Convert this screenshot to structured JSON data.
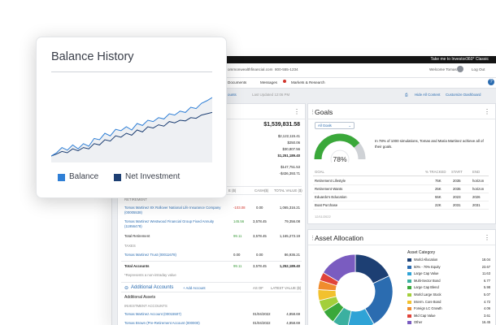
{
  "colors": {
    "accent": "#2b6cb0",
    "balance": "#2f7fd6",
    "net_investment": "#1d3f73",
    "goal_green": "#3aa83a",
    "goal_grey": "#cfd2d6"
  },
  "header": {
    "top_link": "Take me to Investor360° Classic",
    "site_email": "ommonwealthfinancial.com",
    "phone": "800-555-1234",
    "welcome": "Welcome Tomas",
    "logout": "Log Out"
  },
  "nav": {
    "items": [
      "Documents",
      "Messages",
      "Markets & Research"
    ]
  },
  "subbar": {
    "accounts_dropdown": "ounts",
    "last_updated": "Last Updated 12:06 PM",
    "hide_all": "Hide All Content",
    "customize": "Customize Dashboard"
  },
  "balance_card": {
    "title": "Balance History",
    "legend_balance": "Balance",
    "legend_net": "Net Investment",
    "balance_series": [
      0.05,
      0.1,
      0.18,
      0.14,
      0.22,
      0.16,
      0.24,
      0.2,
      0.32,
      0.3,
      0.4,
      0.36,
      0.46,
      0.44,
      0.5,
      0.45,
      0.55,
      0.52,
      0.6,
      0.58,
      0.64,
      0.62,
      0.7,
      0.68,
      0.74,
      0.72,
      0.8,
      0.78,
      0.86,
      0.9,
      0.95
    ],
    "net_series": [
      0.05,
      0.08,
      0.12,
      0.1,
      0.16,
      0.13,
      0.18,
      0.16,
      0.24,
      0.22,
      0.3,
      0.28,
      0.36,
      0.34,
      0.4,
      0.37,
      0.45,
      0.42,
      0.5,
      0.48,
      0.53,
      0.51,
      0.58,
      0.56,
      0.6,
      0.59,
      0.64,
      0.63,
      0.68,
      0.7,
      0.72
    ]
  },
  "left": {
    "total_main": "$1,539,831.58",
    "amounts": [
      "$2,122,115.41",
      "$250.06",
      "$30,807.56",
      "$1,251,189.40"
    ],
    "amounts2": [
      "$147,751.53",
      "-$436,393.71"
    ],
    "col_headers": [
      "E ($)",
      "CASH($)",
      "TOTAL VALUE ($)"
    ],
    "section_retirement": "RETIREMENT",
    "rows": [
      {
        "name": "Tomas Martinez 8X Rollover National Life Insurance Company (00005538)",
        "change": "-103.08",
        "cash": "0.00",
        "total": "1,065,316.21"
      },
      {
        "name": "Tomas Martinez Westwood Financial Group Fixed Annuity (11956478)",
        "change": "145.56",
        "cash": "3,578.45",
        "total": "79,356.08"
      }
    ],
    "total_retirement": {
      "label": "Total Retirement",
      "change": "99.11",
      "cash": "3,578.45",
      "total": "1,165,273.19"
    },
    "section_taxes": "TAXES",
    "trust": {
      "name": "Tomas Martinez Trust (00011678)",
      "change": "0.00",
      "cash": "0.00",
      "total": "86,936.21"
    },
    "total_accounts": {
      "label": "Total Accounts",
      "change": "99.11",
      "cash": "3,578.45",
      "total": "1,252,189.40"
    },
    "note": "*Represents a non-intraday value",
    "additional_title": "Additional Accounts",
    "add_account": "+ Add Account",
    "as_of_header": "AS OF",
    "latest_header": "LATEST VALUE ($)",
    "additional_assets": "Additional Assets",
    "investment_accounts": "INVESTMENT ACCOUNTS",
    "inv_rows": [
      {
        "name": "Tomas Martinez Account (00015507)",
        "date": "01/04/2022",
        "value": "4,858.69"
      },
      {
        "name": "Tomas Brown (Pre-Retirement Account (000000)",
        "date": "01/04/2022",
        "value": "4,858.69"
      }
    ]
  },
  "goals": {
    "title": "Goals",
    "filter": "All Goals",
    "percent": 0.78,
    "percent_label": "78%",
    "description": "In 78% of 1000 simulations, Tomas and Maria Martinez achieve all of their goals.",
    "headers": [
      "GOAL",
      "% TRACKED",
      "START",
      "END"
    ],
    "rows": [
      {
        "goal": "Retirement Lifestyle",
        "pct": "75K",
        "start": "2035",
        "end": "horizon"
      },
      {
        "goal": "Retirement Wants",
        "pct": "25K",
        "start": "2035",
        "end": "horizon"
      },
      {
        "goal": "Eduardo's Education",
        "pct": "55K",
        "start": "2023",
        "end": "2026"
      },
      {
        "goal": "Boat Purchase",
        "pct": "22K",
        "start": "2031",
        "end": "2031"
      }
    ],
    "date": "12/11/2022"
  },
  "allocation": {
    "title": "Asset Allocation",
    "category_header": "Asset Category",
    "items": [
      {
        "name": "World Allocation",
        "value": "18.04",
        "color": "#1d3f73"
      },
      {
        "name": "50% - 70% Equity",
        "value": "23.67",
        "color": "#2b6cb0"
      },
      {
        "name": "Large Cap Value",
        "value": "11.63",
        "color": "#2fa3d6"
      },
      {
        "name": "Multi-Sector Bond",
        "value": "6.77",
        "color": "#3bb0a0"
      },
      {
        "name": "Large Cap Blend",
        "value": "5.98",
        "color": "#3aa83a"
      },
      {
        "name": "World Large Stock",
        "value": "5.07",
        "color": "#a3cf3a"
      },
      {
        "name": "Interm. Core Bond",
        "value": "4.72",
        "color": "#f2c12e"
      },
      {
        "name": "Foreign LC Growth",
        "value": "4.06",
        "color": "#f08c2e"
      },
      {
        "name": "Mid Cap Value",
        "value": "3.61",
        "color": "#e0433a"
      },
      {
        "name": "Other",
        "value": "16.45",
        "color": "#7a5cc0"
      }
    ]
  }
}
